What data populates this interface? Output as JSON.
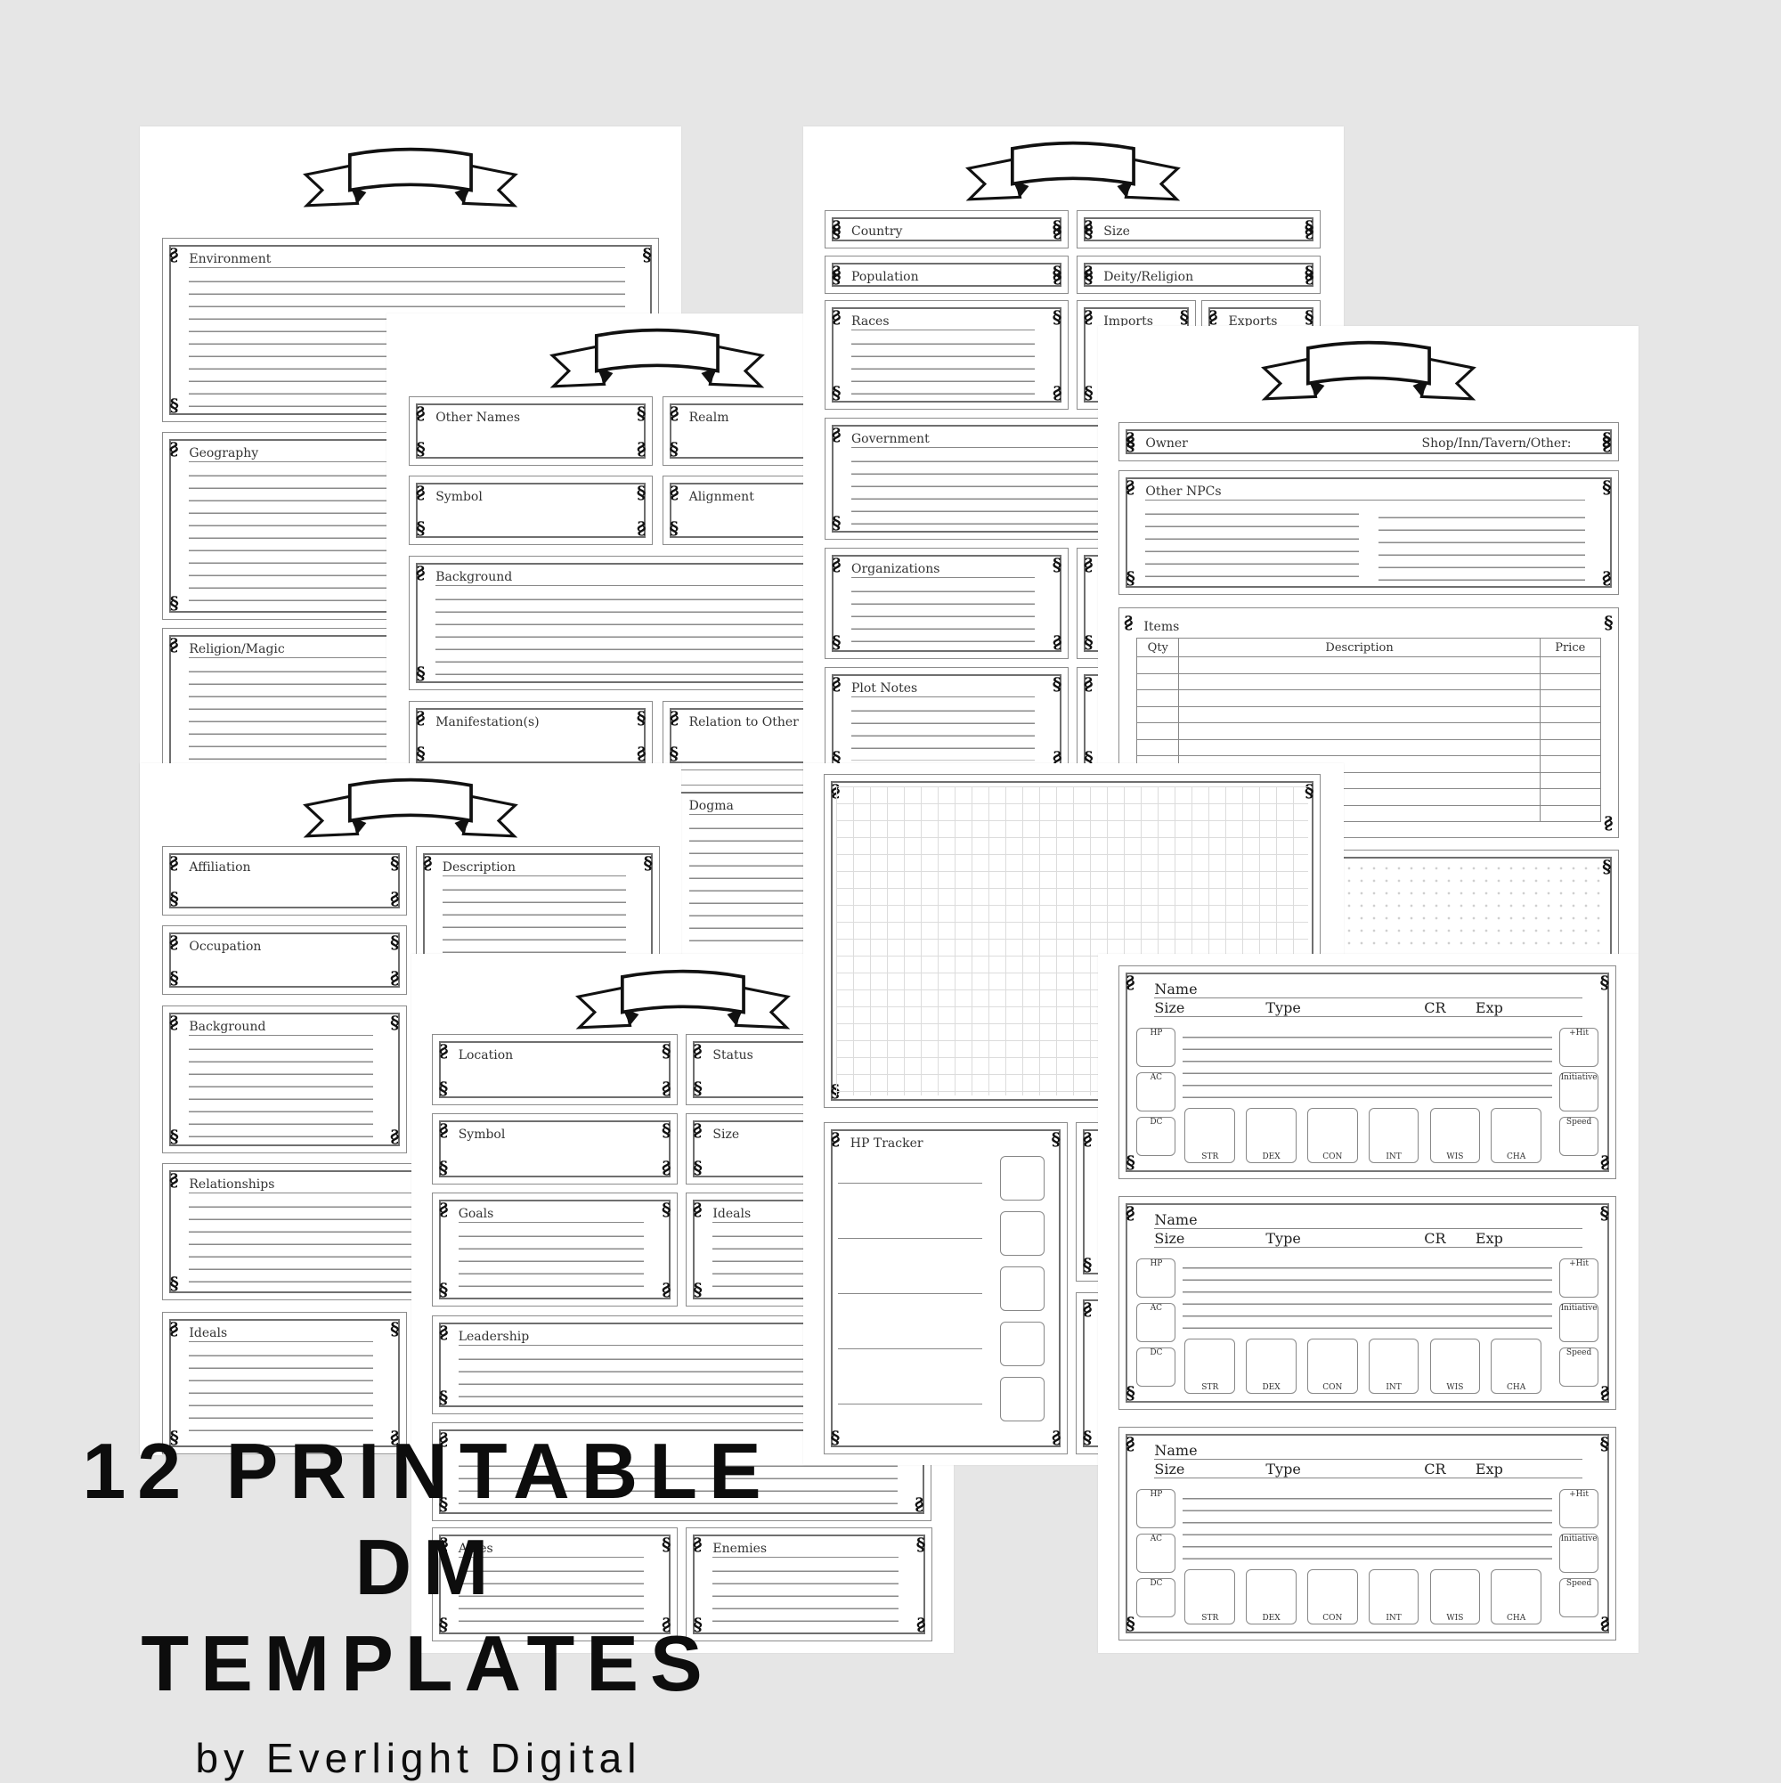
{
  "background_color": "#e6e6e6",
  "pages": {
    "setting": {
      "labels": [
        "Environment",
        "Geography",
        "Religion/Magic"
      ]
    },
    "country": {
      "labels": [
        "Country",
        "Size",
        "Population",
        "Deity/Religion",
        "Races",
        "Imports",
        "Exports",
        "Government",
        "Organizations",
        "Plot Notes"
      ]
    },
    "deity": {
      "labels": [
        "Other Names",
        "Realm",
        "Symbol",
        "Alignment",
        "Background",
        "Manifestation(s)",
        "Relation to Other Deities",
        "Dogma"
      ]
    },
    "npc": {
      "labels": [
        "Affiliation",
        "Description",
        "Occupation",
        "Background",
        "Relationships",
        "Ideals"
      ]
    },
    "faction": {
      "labels": [
        "Location",
        "Status",
        "Symbol",
        "Size",
        "Goals",
        "Ideals",
        "Leadership",
        "Allies",
        "Enemies"
      ]
    },
    "shop": {
      "labels": [
        "Owner",
        "Other NPCs",
        "Items"
      ],
      "owner_extra": "Shop/Inn/Tavern/Other:",
      "table_columns": [
        "Qty",
        "Description",
        "Price"
      ]
    },
    "map": {
      "labels": [
        "HP Tracker"
      ]
    },
    "monster": {
      "name": "Name",
      "size": "Size",
      "type": "Type",
      "cr": "CR",
      "exp": "Exp",
      "left": [
        "HP",
        "AC",
        "DC"
      ],
      "right": [
        "+Hit",
        "Initiative",
        "Speed"
      ],
      "abilities": [
        "STR",
        "DEX",
        "CON",
        "INT",
        "WIS",
        "CHA"
      ]
    }
  },
  "title": {
    "line1": "12 PRINTABLE",
    "line2": "DM",
    "line3": "TEMPLATES",
    "byline": "by Everlight Digital"
  }
}
